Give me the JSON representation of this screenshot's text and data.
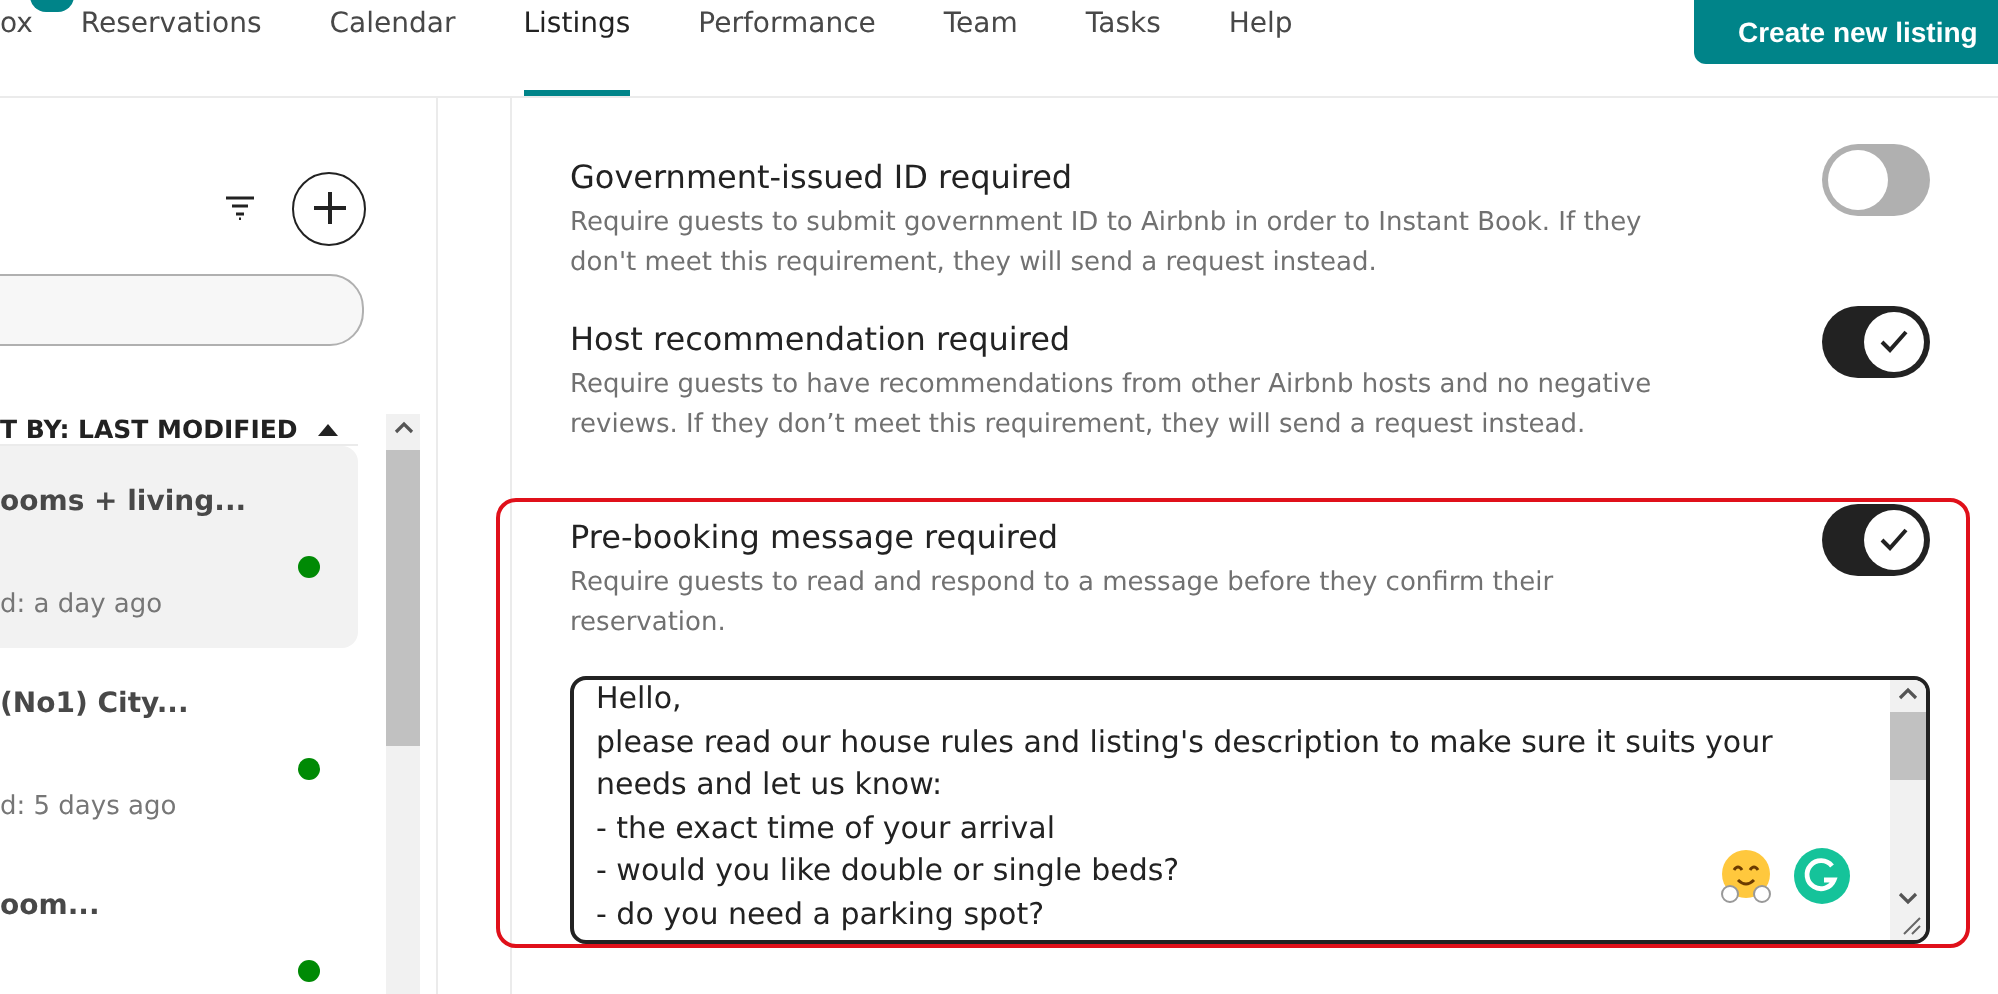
{
  "nav": {
    "tabs": [
      {
        "label": "ox",
        "selected": false
      },
      {
        "label": "Reservations",
        "selected": false
      },
      {
        "label": "Calendar",
        "selected": false
      },
      {
        "label": "Listings",
        "selected": true
      },
      {
        "label": "Performance",
        "selected": false
      },
      {
        "label": "Team",
        "selected": false
      },
      {
        "label": "Tasks",
        "selected": false
      },
      {
        "label": "Help",
        "selected": false
      }
    ],
    "create_button": "Create new listing"
  },
  "sidebar": {
    "sort_label": "T BY: LAST MODIFIED",
    "listings": [
      {
        "title": "ooms + living...",
        "modified": "d: a day ago",
        "selected": true,
        "color": "#008a05"
      },
      {
        "title": "(No1) City...",
        "modified": "d: 5 days ago",
        "selected": false,
        "color": "#008a05"
      },
      {
        "title": "oom...",
        "selected": false,
        "color": "#008a05"
      }
    ]
  },
  "settings": [
    {
      "title": "Government-issued ID required",
      "description": "Require guests to submit government ID to Airbnb in order to Instant Book. If they don't meet this requirement, they will send a request instead.",
      "on": false,
      "highlighted": false
    },
    {
      "title": "Host recommendation required",
      "description": "Require guests to have recommendations from other Airbnb hosts and no negative reviews. If they don’t meet this requirement, they will send a request instead.",
      "on": true,
      "highlighted": false
    },
    {
      "title": "Pre-booking message required",
      "description": "Require guests to read and respond to a message before they confirm their reservation.",
      "on": true,
      "highlighted": true,
      "message": [
        "Hello,",
        "please read our house rules and listing's description to make sure it suits your needs and let us know:",
        "- the exact time of your arrival",
        "- would you like double or single beds?",
        "- do you need a parking spot?"
      ]
    }
  ]
}
